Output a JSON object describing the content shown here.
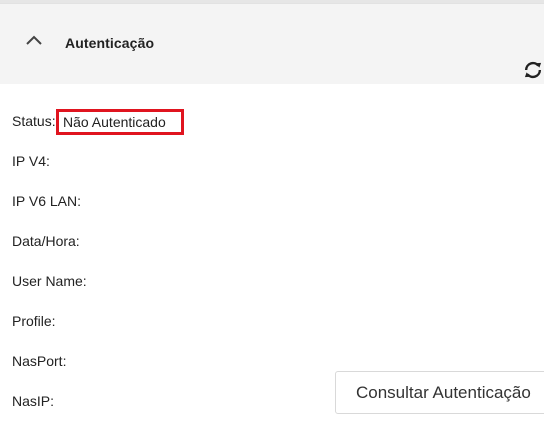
{
  "header": {
    "title": "Autenticação",
    "collapse_icon": "chevron-up-icon",
    "refresh_icon": "refresh-icon"
  },
  "fields": {
    "status_label": "Status:",
    "status_value": "Não Autenticado",
    "ipv4_label": "IP V4:",
    "ipv6_label": "IP V6 LAN:",
    "datetime_label": "Data/Hora:",
    "username_label": "User Name:",
    "profile_label": "Profile:",
    "nasport_label": "NasPort:",
    "nasip_label": "NasIP:"
  },
  "actions": {
    "consult_label": "Consultar Autenticação"
  },
  "colors": {
    "highlight": "#e0141f",
    "header_bg": "#f4f4f4"
  }
}
